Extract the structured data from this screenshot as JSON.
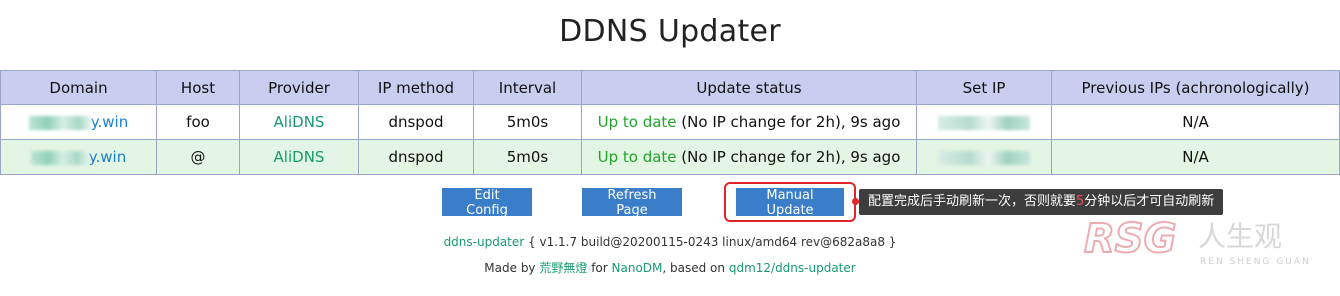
{
  "page": {
    "title": "DDNS Updater"
  },
  "table": {
    "headers": [
      "Domain",
      "Host",
      "Provider",
      "IP method",
      "Interval",
      "Update status",
      "Set IP",
      "Previous IPs (achronologically)"
    ],
    "rows": [
      {
        "domain_suffix": "y.win",
        "host": "foo",
        "provider": "AliDNS",
        "ip_method": "dnspod",
        "interval": "5m0s",
        "status_ok": "Up to date",
        "status_detail": " (No IP change for 2h), 9s ago",
        "previous_ips": "N/A"
      },
      {
        "domain_suffix": "y.win",
        "host": "@",
        "provider": "AliDNS",
        "ip_method": "dnspod",
        "interval": "5m0s",
        "status_ok": "Up to date",
        "status_detail": " (No IP change for 2h), 9s ago",
        "previous_ips": "N/A"
      }
    ]
  },
  "buttons": {
    "edit_config": "Edit Config",
    "refresh_page": "Refresh Page",
    "manual_update": "Manual Update"
  },
  "tooltip": {
    "before": "配置完成后手动刷新一次，否则就要",
    "emph": "5",
    "after": "分钟以后才可自动刷新"
  },
  "footer": {
    "app_link": "ddns-updater",
    "version_text": " { v1.1.7 build@20200115-0243 linux/amd64 rev@682a8a8 }",
    "made_by": "Made by ",
    "author": "荒野無燈",
    "for_text": " for ",
    "target": "NanoDM",
    "based_on": ", based on ",
    "upstream": "qdm12/ddns-updater"
  },
  "watermark": {
    "logo": "RSG",
    "cn": "人生观",
    "en": "REN SHENG GUAN"
  },
  "colors": {
    "header_bg": "#c9cdf0",
    "row_alt_bg": "#e3f5e3",
    "button_bg": "#3a7dc9",
    "highlight": "#e0242b",
    "ok_green": "#22a52a"
  }
}
